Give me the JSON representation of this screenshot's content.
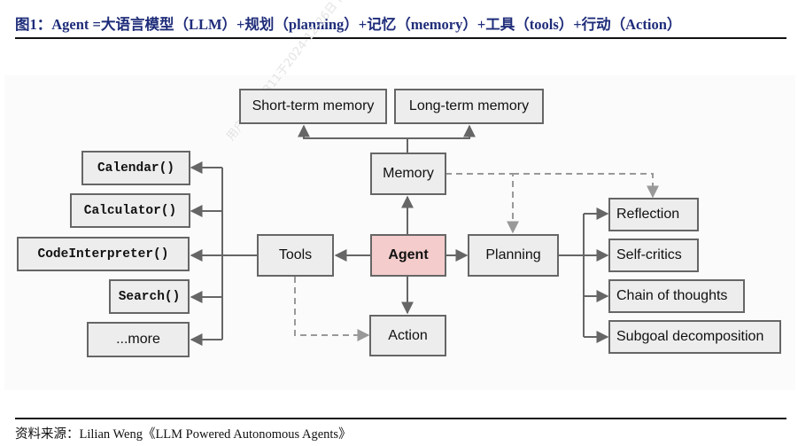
{
  "figure": {
    "title": "图1：Agent =大语言模型（LLM）+规划（planning）+记忆（memory）+工具（tools）+行动（Action）",
    "source": "资料来源：Lilian Weng《LLM Powered Autonomous Agents》",
    "watermark": "用户97756311于2024-12-26日下载，仅供本人内部使用"
  },
  "colors": {
    "title": "#1f2d7a",
    "box_fill": "#ededed",
    "agent_fill": "#f4cccc",
    "border": "#666666",
    "dashed": "#999999"
  },
  "diagram": {
    "center": "Agent",
    "memory": {
      "label": "Memory",
      "children": [
        "Short-term memory",
        "Long-term memory"
      ]
    },
    "tools": {
      "label": "Tools",
      "children": [
        "Calendar()",
        "Calculator()",
        "CodeInterpreter()",
        "Search()",
        "...more"
      ]
    },
    "planning": {
      "label": "Planning",
      "children": [
        "Reflection",
        "Self-critics",
        "Chain of thoughts",
        "Subgoal decomposition"
      ]
    },
    "action": {
      "label": "Action"
    },
    "dashed_links": [
      {
        "from": "Memory",
        "to": "Planning"
      },
      {
        "from": "Memory",
        "to": "Reflection"
      },
      {
        "from": "Tools",
        "to": "Action"
      }
    ]
  }
}
